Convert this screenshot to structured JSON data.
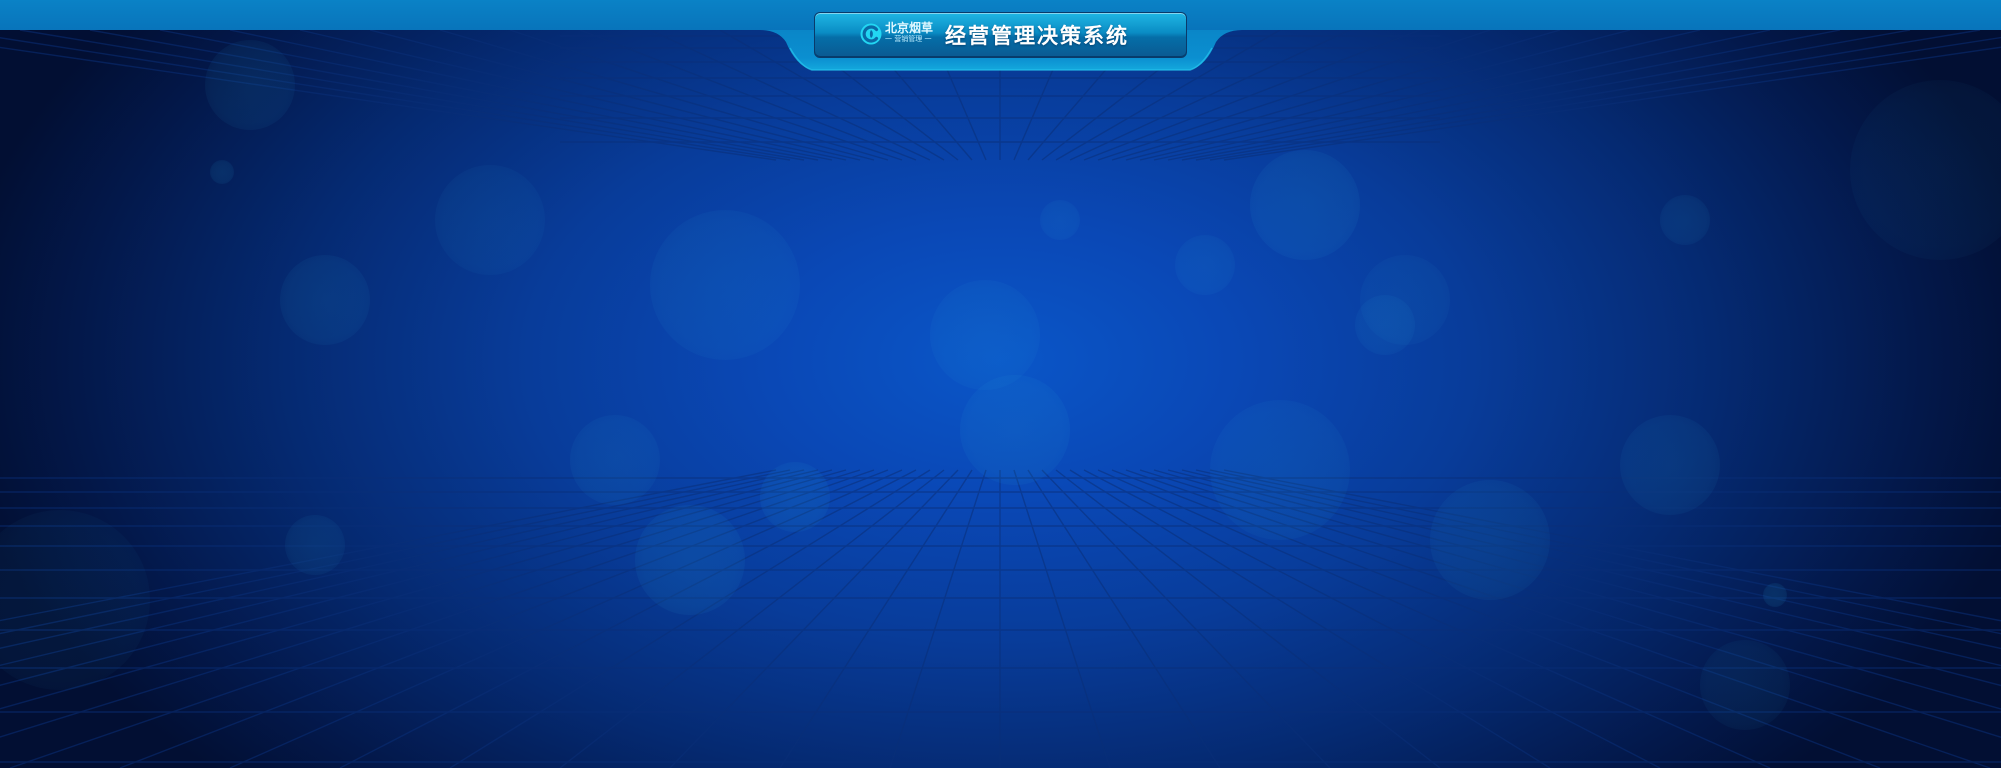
{
  "header": {
    "brand_name": "北京烟草",
    "brand_tagline": "一 营销管理 一",
    "system_title": "经营管理决策系统"
  },
  "icons": {
    "logo": "beijing-tobacco-logo-icon"
  },
  "colors": {
    "top_bar": "#0874bb",
    "background_center": "#0a56c8",
    "background_edge": "#020f33",
    "title_plate": "#0a8cc4",
    "title_text": "#ffffff"
  }
}
